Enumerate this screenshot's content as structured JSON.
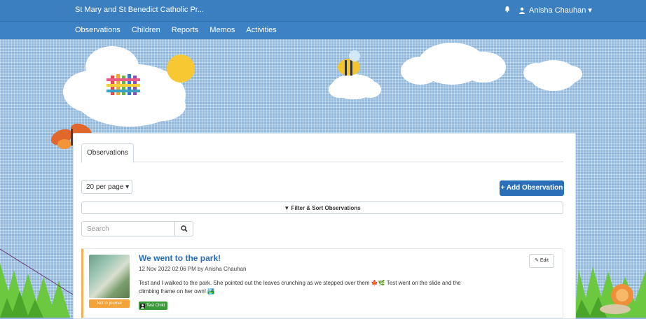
{
  "topbar": {
    "school_name": "St Mary and St Benedict Catholic Pr...",
    "user_name": "Anisha Chauhan ▾",
    "nav": [
      "Observations",
      "Children",
      "Reports",
      "Memos",
      "Activities"
    ]
  },
  "panel": {
    "tab_label": "Observations",
    "per_page": "20 per page ▾",
    "add_button": "+ Add Observation",
    "filter_label": "▼ Filter & Sort Observations",
    "search_placeholder": "Search"
  },
  "observation": {
    "title": "We went to the park!",
    "meta": "12 Nov 2022 02:06 PM by Anisha Chauhan",
    "body": "Test and I walked to the park. She pointed out the leaves crunching as we stepped over them 🍁🌿 Test went on the slide and the climbing frame on her own! 🏞️",
    "journal_badge": "Not in journal",
    "edit_label": "✎ Edit",
    "child_tag": "Test Child"
  },
  "colors": {
    "navbar": "#3d82c4",
    "primary": "#2a6fb7",
    "journal_badge": "#f2a33a",
    "child_tag": "#3a9a3a"
  }
}
